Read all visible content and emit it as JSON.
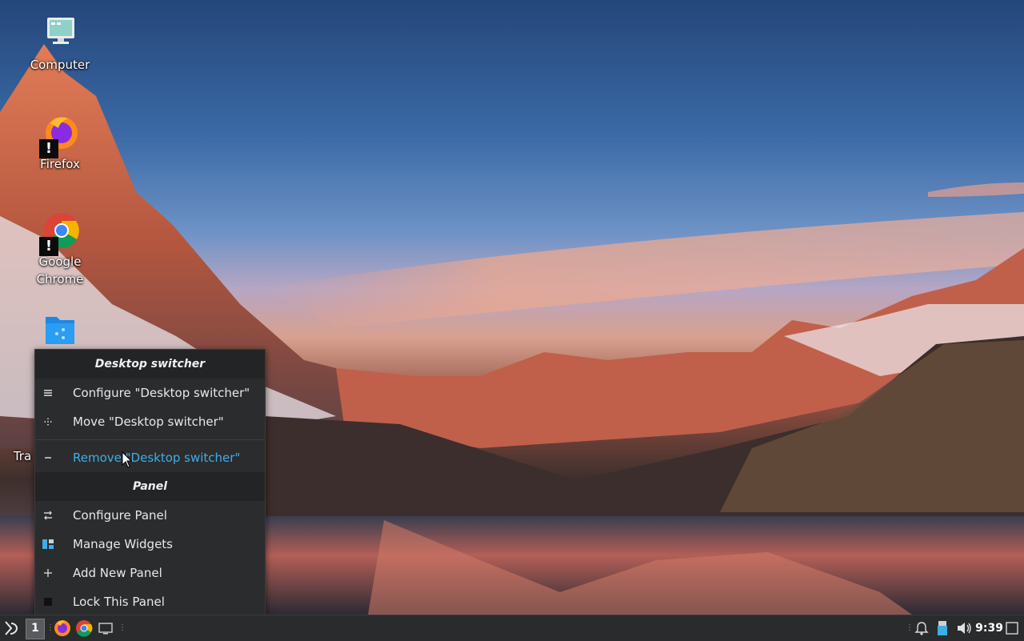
{
  "desktop": {
    "icons": [
      {
        "label": "Computer",
        "icon": "monitor-icon"
      },
      {
        "label": "Firefox",
        "icon": "firefox-icon"
      },
      {
        "label": "Google Chrome",
        "icon": "chrome-icon"
      },
      {
        "label": "",
        "icon": "shared-folder-icon"
      },
      {
        "label": "Tra",
        "icon": "trash-icon"
      }
    ]
  },
  "context_menu": {
    "widget_section_title": "Desktop switcher",
    "widget_items": [
      {
        "label": "Configure \"Desktop switcher\"",
        "icon": "hamburger-icon"
      },
      {
        "label": "Move \"Desktop switcher\"",
        "icon": "move-icon"
      },
      {
        "label": "Remove \"Desktop switcher\"",
        "icon": "minus-icon",
        "highlighted": true
      }
    ],
    "panel_section_title": "Panel",
    "panel_items": [
      {
        "label": "Configure Panel",
        "icon": "configure-arrows-icon"
      },
      {
        "label": "Manage Widgets",
        "icon": "widgets-icon"
      },
      {
        "label": "Add New Panel",
        "icon": "plus-icon"
      },
      {
        "label": "Lock This Panel",
        "icon": "lock-square-icon"
      }
    ],
    "highlight_color": "#3daee9"
  },
  "taskbar": {
    "desktop_number": "1",
    "clock": "9:39",
    "launchers": [
      "firefox-icon",
      "chrome-icon",
      "show-desktop-icon"
    ],
    "tray": [
      "notification-bell-icon",
      "usb-device-icon",
      "volume-icon"
    ]
  }
}
